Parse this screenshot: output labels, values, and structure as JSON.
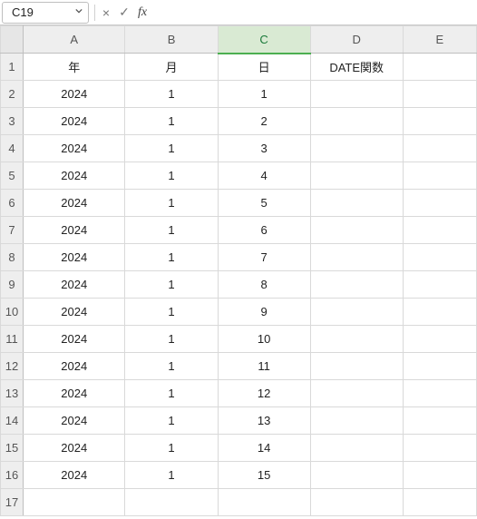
{
  "formula_bar": {
    "cell_ref": "C19",
    "chevron_label": "v",
    "cancel_glyph": "×",
    "confirm_glyph": "✓",
    "fx_label": "fx",
    "formula_value": ""
  },
  "grid": {
    "column_labels": [
      "A",
      "B",
      "C",
      "D",
      "E"
    ],
    "visible_rows": 17,
    "selected_column": "C",
    "headers": {
      "A": "年",
      "B": "月",
      "C": "日",
      "D": "DATE関数",
      "E": ""
    },
    "rows": [
      {
        "A": "2024",
        "B": "1",
        "C": "1",
        "D": "",
        "E": ""
      },
      {
        "A": "2024",
        "B": "1",
        "C": "2",
        "D": "",
        "E": ""
      },
      {
        "A": "2024",
        "B": "1",
        "C": "3",
        "D": "",
        "E": ""
      },
      {
        "A": "2024",
        "B": "1",
        "C": "4",
        "D": "",
        "E": ""
      },
      {
        "A": "2024",
        "B": "1",
        "C": "5",
        "D": "",
        "E": ""
      },
      {
        "A": "2024",
        "B": "1",
        "C": "6",
        "D": "",
        "E": ""
      },
      {
        "A": "2024",
        "B": "1",
        "C": "7",
        "D": "",
        "E": ""
      },
      {
        "A": "2024",
        "B": "1",
        "C": "8",
        "D": "",
        "E": ""
      },
      {
        "A": "2024",
        "B": "1",
        "C": "9",
        "D": "",
        "E": ""
      },
      {
        "A": "2024",
        "B": "1",
        "C": "10",
        "D": "",
        "E": ""
      },
      {
        "A": "2024",
        "B": "1",
        "C": "11",
        "D": "",
        "E": ""
      },
      {
        "A": "2024",
        "B": "1",
        "C": "12",
        "D": "",
        "E": ""
      },
      {
        "A": "2024",
        "B": "1",
        "C": "13",
        "D": "",
        "E": ""
      },
      {
        "A": "2024",
        "B": "1",
        "C": "14",
        "D": "",
        "E": ""
      },
      {
        "A": "2024",
        "B": "1",
        "C": "15",
        "D": "",
        "E": ""
      }
    ]
  }
}
